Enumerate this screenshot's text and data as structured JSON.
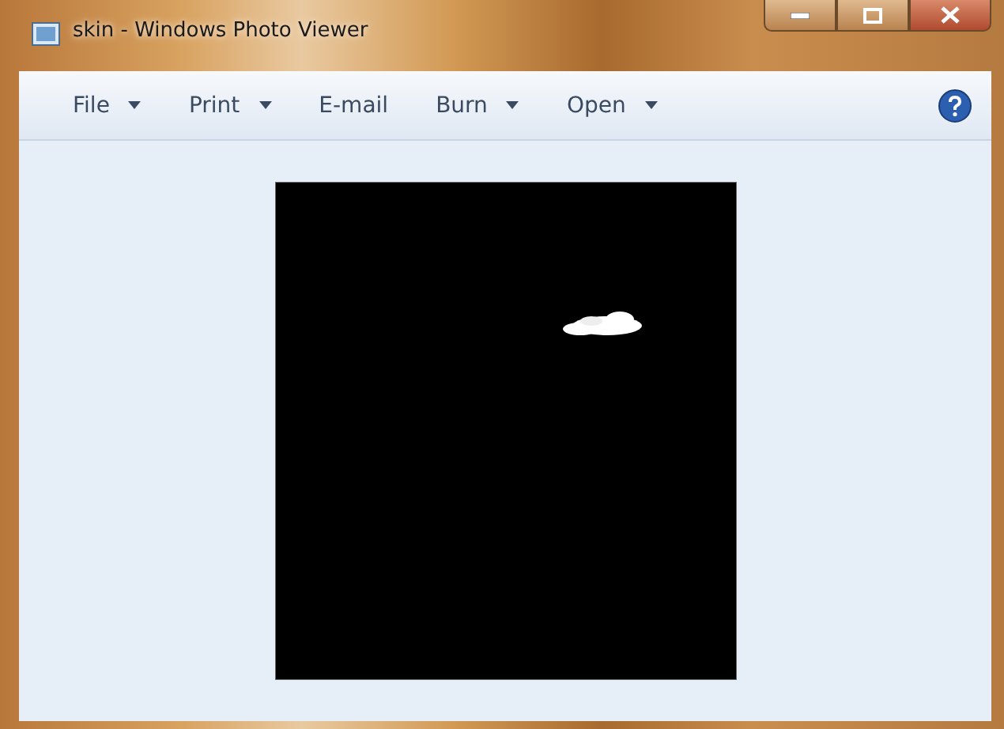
{
  "window": {
    "title": "skin - Windows Photo Viewer"
  },
  "toolbar": {
    "items": [
      {
        "label": "File",
        "dropdown": true
      },
      {
        "label": "Print",
        "dropdown": true
      },
      {
        "label": "E-mail",
        "dropdown": false
      },
      {
        "label": "Burn",
        "dropdown": true
      },
      {
        "label": "Open",
        "dropdown": true
      }
    ]
  }
}
